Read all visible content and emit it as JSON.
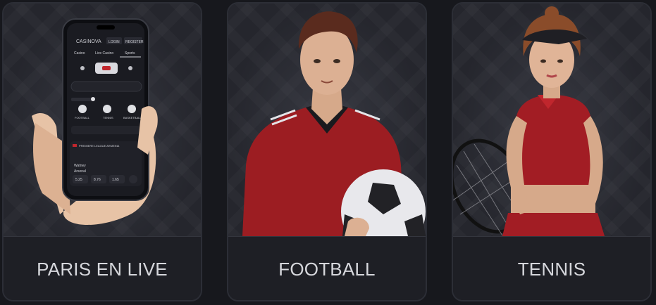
{
  "cards": [
    {
      "title": "PARIS EN LIVE",
      "phone": {
        "brand": "CASINOVA",
        "login": "LOGIN",
        "register": "REGISTER",
        "tabs": [
          "Casino",
          "Live Casino",
          "Sports"
        ],
        "sports": [
          "FOOTBALL",
          "TENNIS",
          "BASKETBALL"
        ],
        "league": "PREMIERE LEAGUE ARMENIA",
        "teams": [
          "Watney",
          "Arsenal"
        ],
        "odds": [
          "5.25",
          "8.76",
          "1.65"
        ]
      }
    },
    {
      "title": "FOOTBALL"
    },
    {
      "title": "TENNIS"
    }
  ],
  "colors": {
    "background": "#17181d",
    "card_border": "#2c2e36",
    "label_text": "#d6d7dc",
    "jersey_red": "#9c1d22",
    "accent_red": "#c0262d"
  }
}
